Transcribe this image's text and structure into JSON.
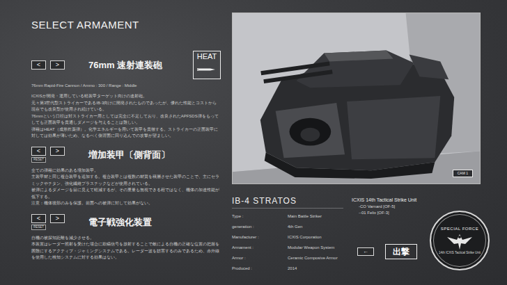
{
  "title": "SELECT ARMAMENT",
  "armaments": [
    {
      "kind": "weapon",
      "prev": "<",
      "next": ">",
      "title": "76mm 速射連装砲",
      "badge": "HEAT",
      "subtitle": "76mm Rapid-Fire Cannon / Ammo : 300 / Range : Middle",
      "paragraphs": [
        "ICXISが開発・運用している軽装甲ターゲット向けの速射砲。",
        "元々第3世代型ストライカーであるIB-3向けに開発されたものであったが、優れた性能とコストから現在でも改良型が使用され続けている。",
        "76mmという口径は対ストライカー用としては完全に不足しており、改良されたAPFSDS弾をもってしても正面装甲を貫通しダメージを与えることは難しい。",
        "弾種はHEAT（成形炸薬弾）。化学エネルギーを用いて装甲を貫徹する。ストライカーの正面装甲に対しては効果が薄いため、なるべく側背面に回り込んでの攻撃が望ましい。"
      ]
    },
    {
      "kind": "equipment",
      "prev": "<",
      "next": ">",
      "reset": "RESET",
      "title": "増加装甲〔側背面〕",
      "paragraphs": [
        "全ての弾種に効果のある増加装甲。",
        "主装甲材と同じ複合装甲を追加する。複合装甲とは複数の材質を積層させた装甲のことで、主にセラミックやチタン、強化繊維プラスチックなどが使用されている。",
        "被弾によるダメージを目に見えて軽減するが、その重量も無視できる程ではなく、機体の加速性能が低下する。",
        "注意：機体後部のみを保護。前面への被弾に対して効果がない。"
      ]
    },
    {
      "kind": "equipment",
      "prev": "<",
      "next": ">",
      "reset": "RESET",
      "title": "電子戦強化装置",
      "paragraphs": [
        "自機の被探知距離を減少させる。",
        "本装置はレーダー照射を受けた場合に欺瞞信号を放射することで敵による自機の正確な位置の把握を困難にするアクティブ・ジャミングシステムである。レーダー波を妨害するのみであるため、赤外線を使用した検知システムに対する効果はない。"
      ]
    }
  ],
  "viewport": {
    "camera_button": "CAM 1"
  },
  "vehicle": {
    "name": "IB-4 STRATOS",
    "specs": [
      {
        "label": "Type :",
        "value": "Main Battle Striker"
      },
      {
        "label": "generation :",
        "value": "4th Gen"
      },
      {
        "label": "Manufacturer :",
        "value": "ICXIS Corporation"
      },
      {
        "label": "Armament :",
        "value": "Modular Weapon System"
      },
      {
        "label": "Armor :",
        "value": "Ceramic Composive Armor"
      },
      {
        "label": "Produced :",
        "value": "2014"
      }
    ]
  },
  "unit": {
    "name": "ICXIS 14th Tactical Strike Unit",
    "members": [
      "-CO Varnard [OF-5]",
      "--01 Felix [OF-3]"
    ]
  },
  "buttons": {
    "back": "←",
    "sortie": "出撃"
  },
  "emblem": {
    "top": "SPECIAL FORCE",
    "bottom": "14th ICXIS Tactical Strike Unit"
  }
}
